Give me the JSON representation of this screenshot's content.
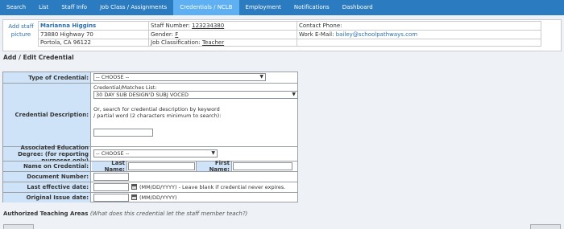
{
  "nav": {
    "tabs": [
      "Search",
      "List",
      "Staff Info",
      "Job Class / Assignments",
      "Credentials / NCLB",
      "Employment",
      "Notifications",
      "Dashboard"
    ],
    "active": "Credentials / NCLB"
  },
  "staff": {
    "add_picture": "Add staff picture",
    "name": "Marianna Higgins",
    "address1": "73880 Highway 70",
    "address2": "Portola, CA 96122",
    "staff_number_label": "Staff Number:",
    "staff_number": "123234380",
    "gender_label": "Gender:",
    "gender": "F",
    "job_class_label": "Job Classification:",
    "job_class": "Teacher",
    "contact_phone_label": "Contact Phone:",
    "work_email_label": "Work E-Mail:",
    "work_email": "bailey@schoolpathways.com"
  },
  "form": {
    "title": "Add / Edit Credential",
    "type_label": "Type of Credential:",
    "type_value": "-- CHOOSE --",
    "desc_label": "Credential Description:",
    "matches_label": "Credential/Matches List:",
    "matches_value": "30 DAY SUB DESIGN'D SUBJ VOCED",
    "search_hint": "Or, search for credential description by keyword / partial word (2 characters minimum to search):",
    "degree_label": "Associated Education Degree: (for reporting purposes only)",
    "degree_value": "-- CHOOSE --",
    "name_label": "Name on Credential:",
    "last_name_label": "Last Name:",
    "first_name_label": "First Name:",
    "doc_label": "Document Number:",
    "last_eff_label": "Last effective date:",
    "last_eff_hint": "(MM/DD/YYYY) - Leave blank if credential never expires.",
    "orig_label": "Original Issue date:",
    "orig_hint": "(MM/DD/YYYY)"
  },
  "auth": {
    "title": "Authorized Teaching Areas",
    "note": "(What does this credential let the staff member teach?)"
  },
  "colors": {
    "nav_bg": "#2b7bc0",
    "nav_active": "#5fb0f2",
    "label_bg": "#cfe3f8",
    "link": "#2a6fb3"
  }
}
